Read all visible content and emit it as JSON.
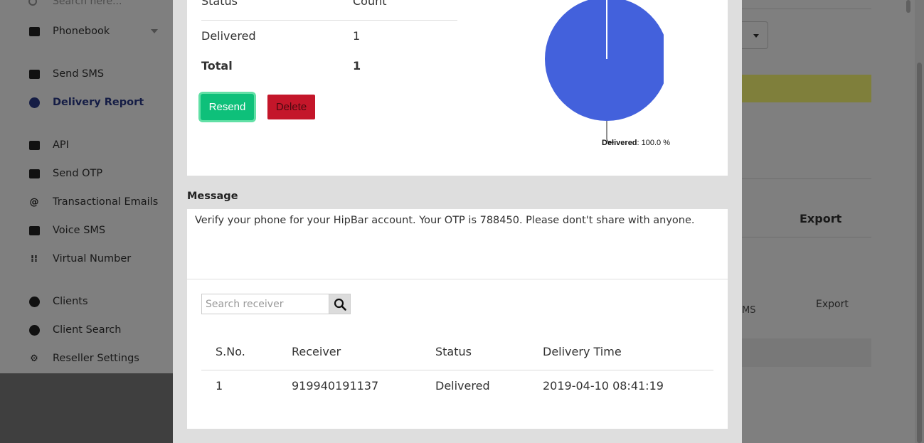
{
  "sidebar": {
    "search_placeholder": "Search here...",
    "items": [
      {
        "label": "Phonebook",
        "icon": "phonebook-icon"
      },
      {
        "label": "Send SMS",
        "icon": "sms-icon"
      },
      {
        "label": "Delivery Report",
        "icon": "pie-chart-icon",
        "active": true
      },
      {
        "label": "API",
        "icon": "api-icon"
      },
      {
        "label": "Send OTP",
        "icon": "otp-icon"
      },
      {
        "label": "Transactional Emails",
        "icon": "at-icon"
      },
      {
        "label": "Voice SMS",
        "icon": "voice-icon"
      },
      {
        "label": "Virtual Number",
        "icon": "dialpad-icon"
      },
      {
        "label": "Clients",
        "icon": "clients-icon"
      },
      {
        "label": "Client Search",
        "icon": "client-search-icon"
      },
      {
        "label": "Reseller Settings",
        "icon": "gear-icon"
      }
    ]
  },
  "background": {
    "export_header": "Export",
    "ms_fragment": "MS",
    "export_link": "Export"
  },
  "summary": {
    "header_status": "Status",
    "header_count": "Count",
    "rows": [
      {
        "status": "Delivered",
        "count": "1"
      }
    ],
    "total_label": "Total",
    "total_value": "1"
  },
  "buttons": {
    "resend": "Resend",
    "delete": "Delete"
  },
  "chart_data": {
    "type": "pie",
    "slices": [
      {
        "label": "Delivered",
        "value": 100.0,
        "color": "#4361dc"
      }
    ],
    "label_suffix": ": 100.0 %"
  },
  "message": {
    "title": "Message",
    "text": "Verify your phone for your HipBar account. Your OTP is 788450. Please dont't share with anyone."
  },
  "receivers": {
    "search_placeholder": "Search receiver",
    "columns": [
      "S.No.",
      "Receiver",
      "Status",
      "Delivery Time"
    ],
    "rows": [
      {
        "sno": "1",
        "receiver": "919940191137",
        "status": "Delivered",
        "time": "2019-04-10 08:41:19"
      }
    ]
  },
  "colors": {
    "accent": "#2b3a8a",
    "resend": "#0ec07a",
    "delete": "#c4162a",
    "pie": "#4361dc"
  }
}
